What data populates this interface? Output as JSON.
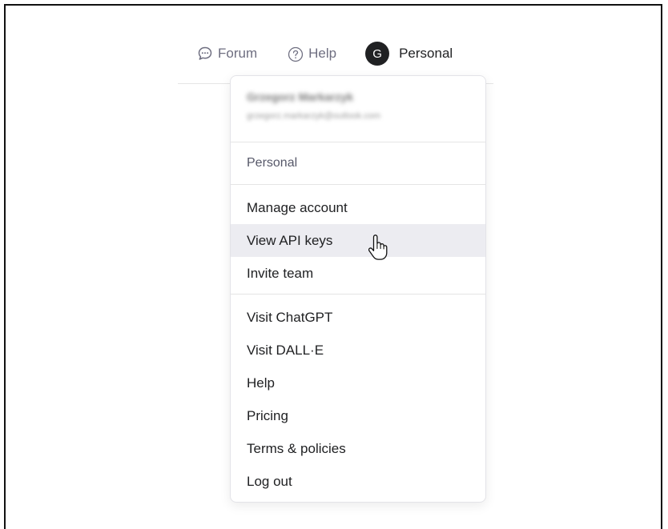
{
  "nav": {
    "forum_label": "Forum",
    "help_label": "Help",
    "avatar_letter": "G",
    "org_label": "Personal"
  },
  "menu": {
    "user": {
      "name": "Grzegorz Markarzyk",
      "email": "grzegorz.markarzyk@outlook.com"
    },
    "organization": "Personal",
    "account_items": [
      {
        "label": "Manage account"
      },
      {
        "label": "View API keys"
      },
      {
        "label": "Invite team"
      }
    ],
    "link_items": [
      {
        "label": "Visit ChatGPT"
      },
      {
        "label": "Visit DALL·E"
      },
      {
        "label": "Help"
      },
      {
        "label": "Pricing"
      },
      {
        "label": "Terms & policies"
      },
      {
        "label": "Log out"
      }
    ],
    "hovered_item": "View API keys"
  },
  "colors": {
    "hover_bg": "#ececf1",
    "avatar_bg": "#202123",
    "muted_text": "#6e6e80"
  },
  "icons": {
    "forum": "speech-bubble-icon",
    "help": "question-circle-icon",
    "cursor": "hand-pointer-icon"
  }
}
